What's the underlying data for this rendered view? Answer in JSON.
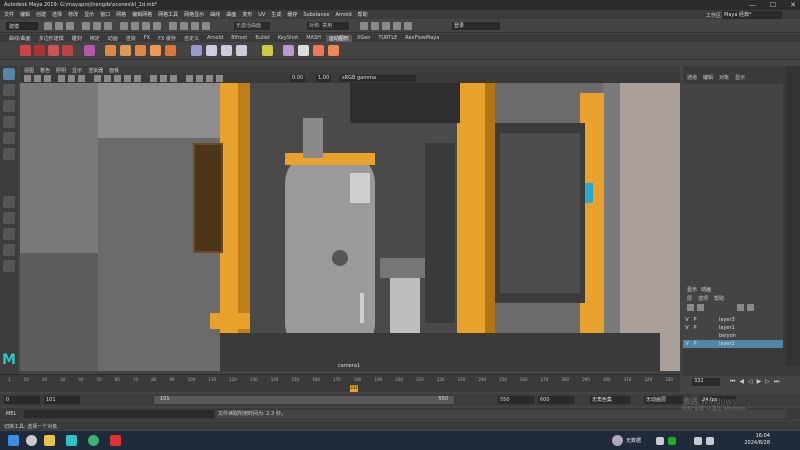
{
  "window": {
    "title": "Autodesk Maya 2019: G:\\mayaproj\\hengde\\scenes\\kl_1d.mb*",
    "min_label": "—",
    "max_label": "☐",
    "close_label": "✕"
  },
  "menubar": [
    "文件",
    "编辑",
    "创建",
    "选择",
    "修改",
    "显示",
    "窗口",
    "网格",
    "编辑网格",
    "网格工具",
    "网格显示",
    "曲线",
    "曲面",
    "变形",
    "UV",
    "生成",
    "缓存",
    "Substance",
    "Arnold",
    "帮助"
  ],
  "statusline": {
    "mode": "建模",
    "input1": "无激活曲面",
    "input2": "对称: 禁用",
    "login": "登录",
    "workspace_label": "工作区:",
    "workspace": "Maya 经典*"
  },
  "shelf_tabs": [
    "曲线/曲面",
    "多边形建模",
    "雕刻",
    "绑定",
    "动画",
    "渲染",
    "FX",
    "FX 缓存",
    "自定义",
    "Arnold",
    "Bifrost",
    "Bullet",
    "KeyShot",
    "MASH",
    "运动图形",
    "XGen",
    "TURTLE"
  ],
  "shelf_tabs_extra": [
    "RexFlowMaya"
  ],
  "active_shelf_tab": "运动图形",
  "viewport": {
    "menu": [
      "视图",
      "着色",
      "照明",
      "显示",
      "渲染器",
      "面板"
    ],
    "exposure": "0.00",
    "gamma": "1.00",
    "colorspace": "sRGB gamma",
    "camera": "camera1",
    "frame_label": "7.00 - 1.00"
  },
  "right_panel": {
    "menu": [
      "通道",
      "编辑",
      "对象",
      "显示"
    ],
    "layers_tabs": [
      "显示",
      "动画"
    ],
    "layers_menu": [
      "层",
      "选项",
      "帮助"
    ],
    "layers": [
      {
        "v": "V",
        "p": "P",
        "name": "layer3",
        "selected": false
      },
      {
        "v": "V",
        "p": "P",
        "name": "layer1",
        "selected": false
      },
      {
        "v": "",
        "p": "",
        "name": "beiyon",
        "selected": false
      },
      {
        "v": "V",
        "p": "P",
        "name": "layer2",
        "selected": true
      }
    ]
  },
  "timeslider": {
    "ticks": [
      "1",
      "10",
      "20",
      "30",
      "40",
      "50",
      "60",
      "70",
      "80",
      "90",
      "100",
      "110",
      "120",
      "130",
      "140",
      "150",
      "160",
      "170",
      "180",
      "190",
      "200",
      "210",
      "220",
      "230",
      "240",
      "250",
      "260",
      "270",
      "280",
      "290",
      "300",
      "310",
      "320",
      "330"
    ],
    "current": "332",
    "current_field": "332"
  },
  "range": {
    "start": "0",
    "min": "101",
    "min2": "101",
    "max": "550",
    "max2": "550",
    "end": "600",
    "char_set": "无角色集",
    "anim_layer": "无动画层",
    "fps": "24 fps"
  },
  "mel": {
    "label": "MEL",
    "result": "文件读取所用时间为: 2.3 秒。"
  },
  "help_line": "切换工具: 选择一个对象",
  "watermark": {
    "title": "激活 Windows",
    "sub": "转到\"设置\"以激活 Windows。"
  },
  "taskbar": {
    "weather": "无数据",
    "time": "16:04",
    "date": "2024/8/28"
  },
  "colors": {
    "accent": "#5285a6",
    "orange": "#e8a12a",
    "maya_logo": "#2ec4c6"
  }
}
